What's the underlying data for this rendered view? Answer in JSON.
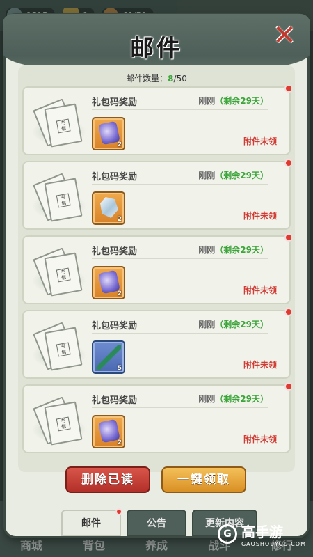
{
  "hud": {
    "stat1": "1515",
    "stat2": "0",
    "stat3": "61/50"
  },
  "bg_nav": [
    "商城",
    "背包",
    "养成",
    "战斗",
    "修行"
  ],
  "panel": {
    "title": "邮件",
    "close_icon": "close-x-icon"
  },
  "mail_count": {
    "label": "邮件数量：",
    "current": "8",
    "max": "/50"
  },
  "mails": [
    {
      "title": "礼包码奖励",
      "time": "刚刚",
      "remain": "（剩余29天）",
      "item_icon": "scroll-purple-icon",
      "qty": "2",
      "status": "附件未领"
    },
    {
      "title": "礼包码奖励",
      "time": "刚刚",
      "remain": "（剩余29天）",
      "item_icon": "crystal-icon",
      "qty": "2",
      "status": "附件未领"
    },
    {
      "title": "礼包码奖励",
      "time": "刚刚",
      "remain": "（剩余29天）",
      "item_icon": "scroll-purple-icon",
      "qty": "2",
      "status": "附件未领"
    },
    {
      "title": "礼包码奖励",
      "time": "刚刚",
      "remain": "（剩余29天）",
      "item_icon": "herb-branch-icon",
      "qty": "5",
      "status": "附件未领"
    },
    {
      "title": "礼包码奖励",
      "time": "刚刚",
      "remain": "（剩余29天）",
      "item_icon": "scroll-purple-icon",
      "qty": "2",
      "status": "附件未领"
    }
  ],
  "buttons": {
    "delete_read": "删除已读",
    "claim_all": "一键领取"
  },
  "tabs": [
    "邮件",
    "公告",
    "更新内容"
  ],
  "watermark": {
    "logo": "G",
    "text": "高手游",
    "sub": "GAOSHOUYOU.COM"
  },
  "colors": {
    "accent_green": "#3ba53a",
    "status_red": "#d23b34",
    "delete_red": "#c0392b",
    "claim_gold": "#e5a33a"
  }
}
